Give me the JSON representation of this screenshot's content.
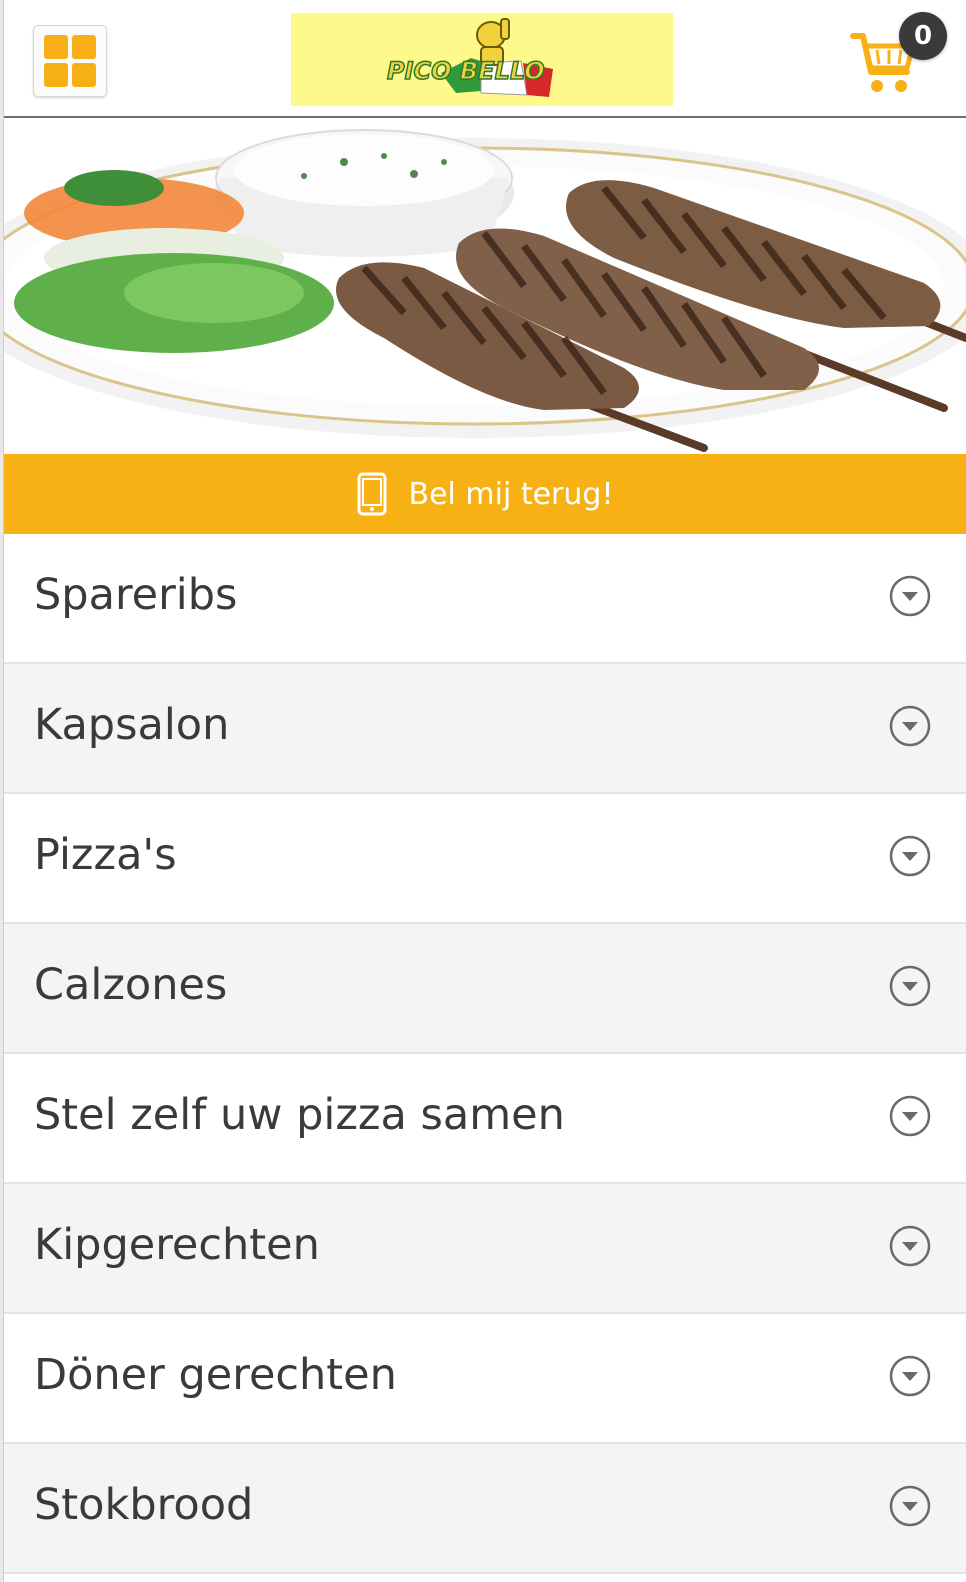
{
  "header": {
    "menu_icon": "grid-icon",
    "logo_text": "PICO BELLO",
    "cart_icon": "shopping-cart-icon",
    "cart_count": "0"
  },
  "colors": {
    "accent": "#f7b114",
    "badge": "#3a3a3a",
    "logo_bg": "#fdf98a"
  },
  "hero": {
    "image": "kebab-skewers-on-plate-with-salad-and-dip"
  },
  "callback": {
    "icon": "mobile-phone-icon",
    "label": "Bel mij terug!"
  },
  "categories": [
    {
      "label": "Spareribs"
    },
    {
      "label": "Kapsalon"
    },
    {
      "label": "Pizza's"
    },
    {
      "label": "Calzones"
    },
    {
      "label": "Stel zelf uw pizza samen"
    },
    {
      "label": "Kipgerechten"
    },
    {
      "label": "Döner gerechten"
    },
    {
      "label": "Stokbrood"
    }
  ]
}
